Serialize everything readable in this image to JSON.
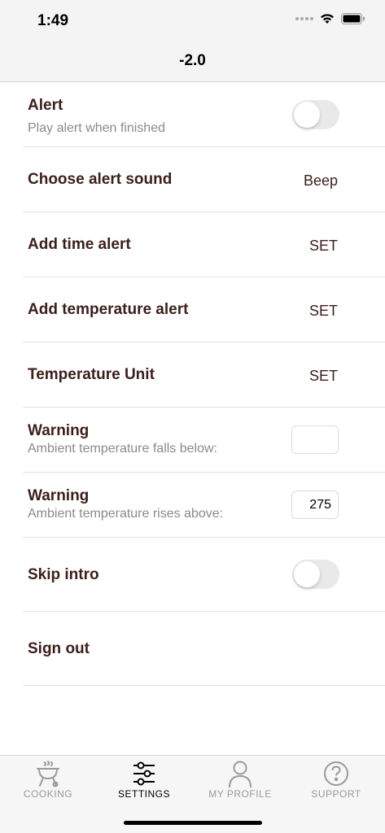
{
  "status_bar": {
    "time": "1:49",
    "wifi_icon": "wifi-icon",
    "battery_icon": "battery-icon"
  },
  "header": {
    "title": "-2.0"
  },
  "settings": {
    "alert": {
      "title": "Alert",
      "subtitle": "Play alert when finished",
      "enabled": false
    },
    "alert_sound": {
      "title": "Choose alert sound",
      "value": "Beep"
    },
    "time_alert": {
      "title": "Add time alert",
      "value": "SET"
    },
    "temp_alert": {
      "title": "Add temperature alert",
      "value": "SET"
    },
    "temp_unit": {
      "title": "Temperature Unit",
      "value": "SET"
    },
    "warning_low": {
      "title": "Warning",
      "subtitle": "Ambient temperature falls below:",
      "value": ""
    },
    "warning_high": {
      "title": "Warning",
      "subtitle": "Ambient temperature rises above:",
      "value": "275"
    },
    "skip_intro": {
      "title": "Skip intro",
      "enabled": false
    },
    "sign_out": {
      "title": "Sign out"
    }
  },
  "tabs": [
    {
      "label": "COOKING",
      "icon": "grill-icon",
      "active": false
    },
    {
      "label": "SETTINGS",
      "icon": "sliders-icon",
      "active": true
    },
    {
      "label": "MY PROFILE",
      "icon": "person-icon",
      "active": false
    },
    {
      "label": "SUPPORT",
      "icon": "help-icon",
      "active": false
    }
  ],
  "colors": {
    "text": "#3b1f1a",
    "subtle": "#8a8a8a",
    "inactive_tab": "#9a9a9a"
  }
}
